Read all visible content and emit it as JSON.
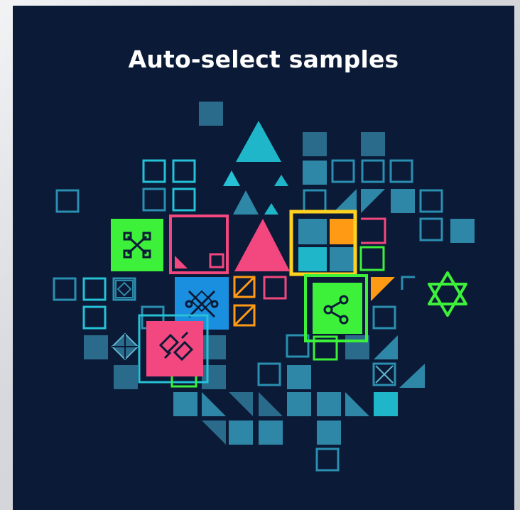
{
  "header": {
    "title": "Auto-select samples"
  },
  "colors": {
    "background": "#0b1a36",
    "title": "#ffffff",
    "tile_dim": "#2a6a8a",
    "tile_mid": "#2f87a8",
    "tile_bright": "#1fb6c9",
    "accent_green": "#3df03a",
    "accent_pink": "#f2477f",
    "accent_yellow": "#ffd21f",
    "accent_orange": "#ff9a14",
    "accent_blue": "#1a8fe0"
  },
  "icons": {
    "green_card": "network-nodes-icon",
    "blue_card": "circuit-x-icon",
    "pink_card": "chain-link-icon",
    "selected_card": "share-icon",
    "star": "hexagram-outline-icon"
  }
}
